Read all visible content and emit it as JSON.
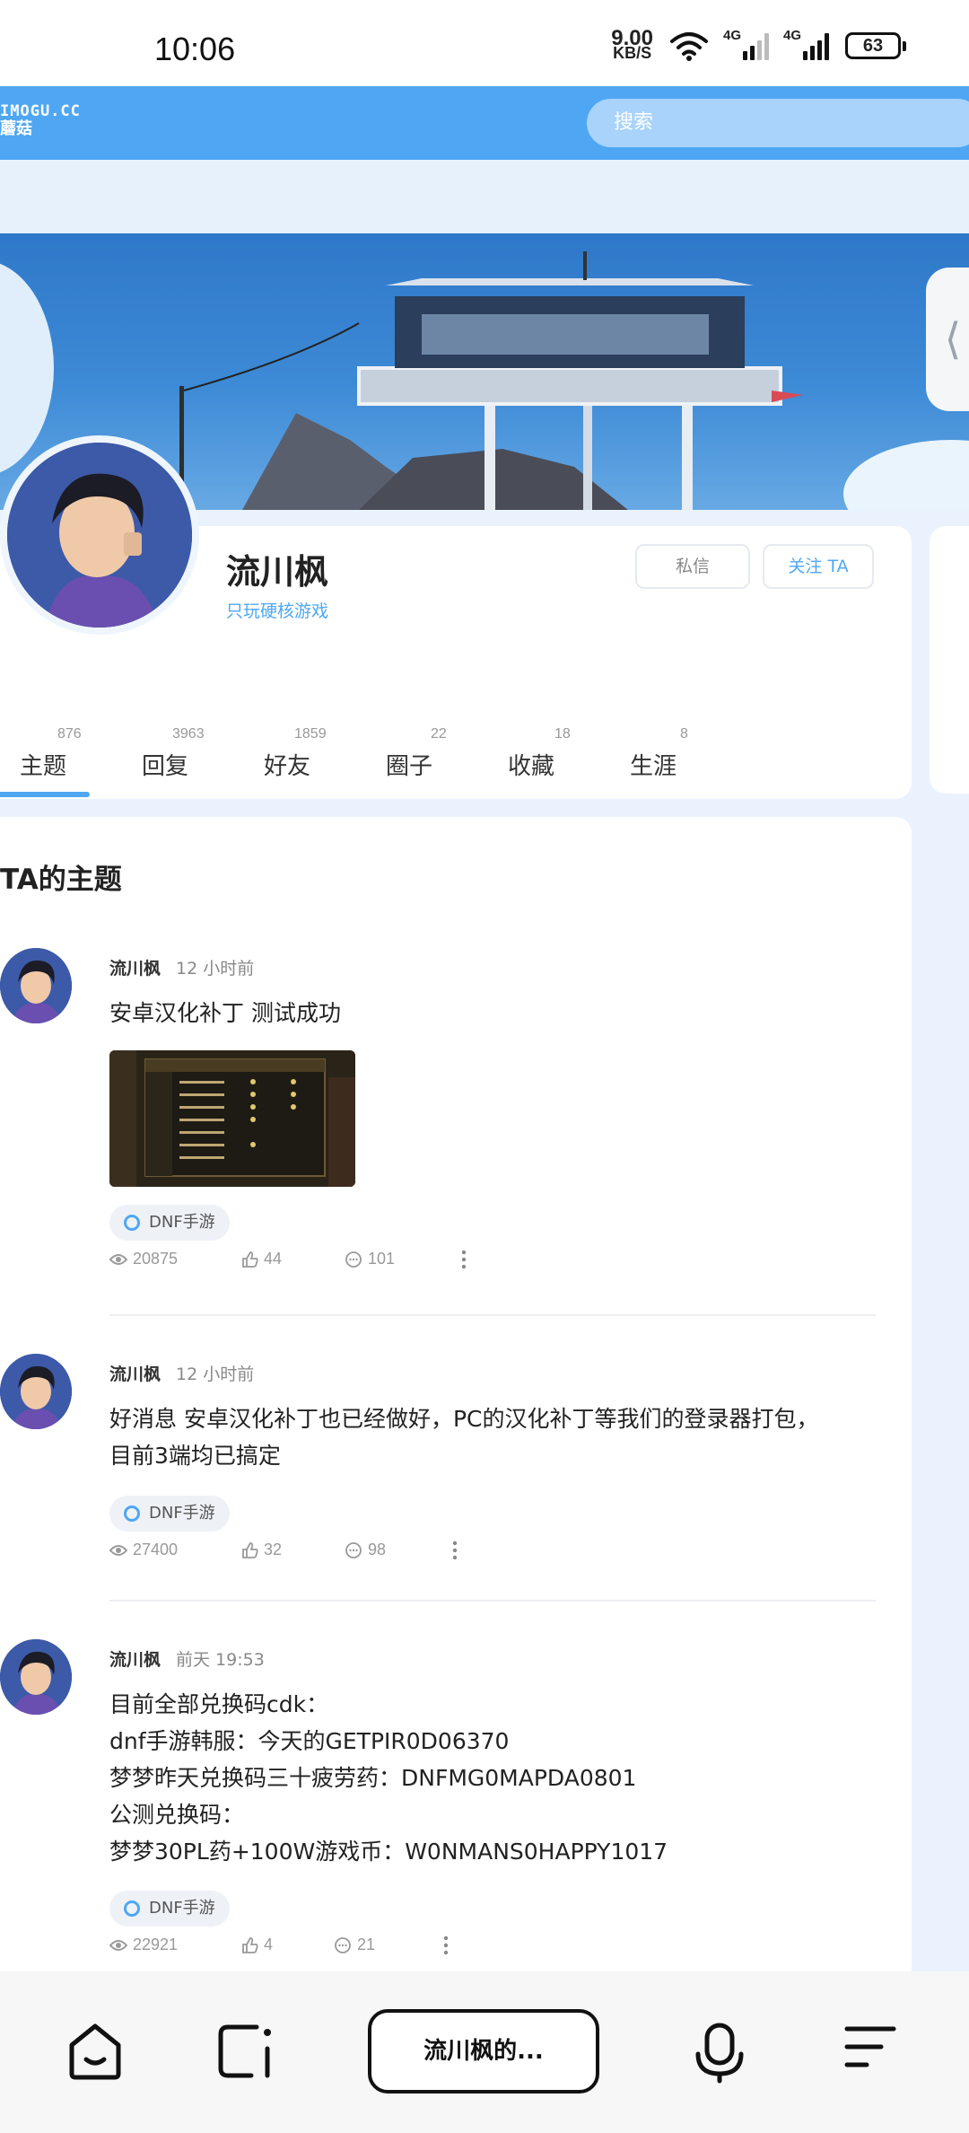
{
  "status": {
    "time": "10:06",
    "net_speed": "9.00",
    "net_unit": "KB/S",
    "sig1_label": "4G",
    "sig2_label": "4G",
    "battery": "63"
  },
  "header": {
    "logo_line1": "IMOGU.CC",
    "logo_line2": "蘑菇",
    "search_placeholder": "搜索"
  },
  "profile": {
    "name": "流川枫",
    "bio": "只玩硬核游戏",
    "message_button": "私信",
    "follow_button": "关注 TA"
  },
  "tabs": [
    {
      "label": "主题",
      "count": "876"
    },
    {
      "label": "回复",
      "count": "3963"
    },
    {
      "label": "好友",
      "count": "1859"
    },
    {
      "label": "圈子",
      "count": "22"
    },
    {
      "label": "收藏",
      "count": "18"
    },
    {
      "label": "生涯",
      "count": "8"
    }
  ],
  "topics": {
    "section_title": "TA的主题",
    "posts": [
      {
        "author": "流川枫",
        "time": "12 小时前",
        "lines": [
          "安卓汉化补丁 测试成功"
        ],
        "tag": "DNF手游",
        "views": "20875",
        "likes": "44",
        "comments": "101"
      },
      {
        "author": "流川枫",
        "time": "12 小时前",
        "lines": [
          "好消息 安卓汉化补丁也已经做好，PC的汉化补丁等我们的登录器打包，",
          "目前3端均已搞定"
        ],
        "tag": "DNF手游",
        "views": "27400",
        "likes": "32",
        "comments": "98"
      },
      {
        "author": "流川枫",
        "time": "前天 19:53",
        "lines": [
          "目前全部兑换码cdk：",
          "dnf手游韩服：今天的GETPIR0D06370",
          "梦梦昨天兑换码三十疲劳药：DNFMG0MAPDA0801",
          "公测兑换码：",
          "梦梦30PL药+100W游戏币：W0NMANS0HAPPY1017"
        ],
        "tag": "DNF手游",
        "views": "22921",
        "likes": "4",
        "comments": "21"
      }
    ]
  },
  "bottom_nav": {
    "title": "流川枫的..."
  },
  "colors": {
    "accent": "#4fa7f3",
    "background": "#eaf3fd"
  }
}
